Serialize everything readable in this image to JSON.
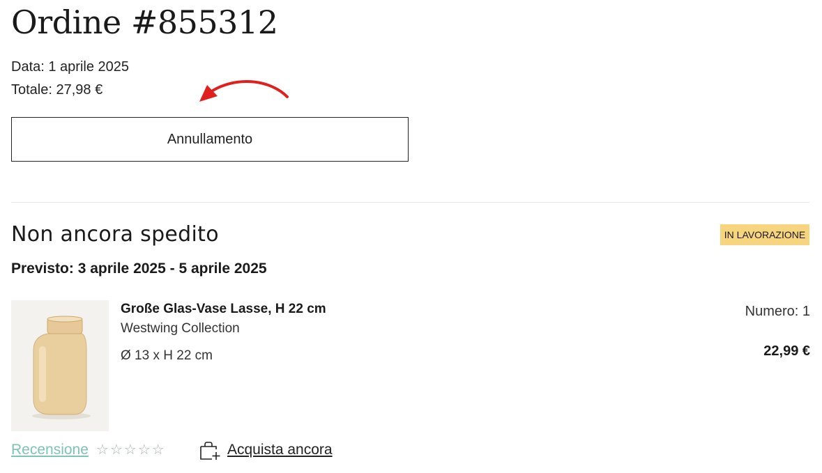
{
  "order": {
    "title": "Ordine #855312",
    "date": "Data: 1 aprile 2025",
    "total": "Totale: 27,98 €",
    "cancel_label": "Annullamento"
  },
  "shipment": {
    "title": "Non ancora spedito",
    "status_badge": "IN LAVORAZIONE",
    "expected": "Previsto: 3 aprile 2025 - 5 aprile 2025"
  },
  "product": {
    "name": "Große Glas-Vase Lasse, H 22 cm",
    "brand": "Westwing Collection",
    "dimensions": "Ø 13 x H 22 cm",
    "quantity": "Numero: 1",
    "price": "22,99 €",
    "image_icon": "vase-image"
  },
  "actions": {
    "review_label": "Recensione",
    "rating_stars": 0,
    "rating_max": 5,
    "buy_again_label": "Acquista ancora",
    "buy_again_icon": "bag-plus-icon"
  },
  "colors": {
    "badge_bg": "#f7d57f",
    "review_link": "#7cc5b0",
    "arrow": "#e0201d",
    "star_outline": "#a9b2b0",
    "divider": "#e6e6e6"
  }
}
